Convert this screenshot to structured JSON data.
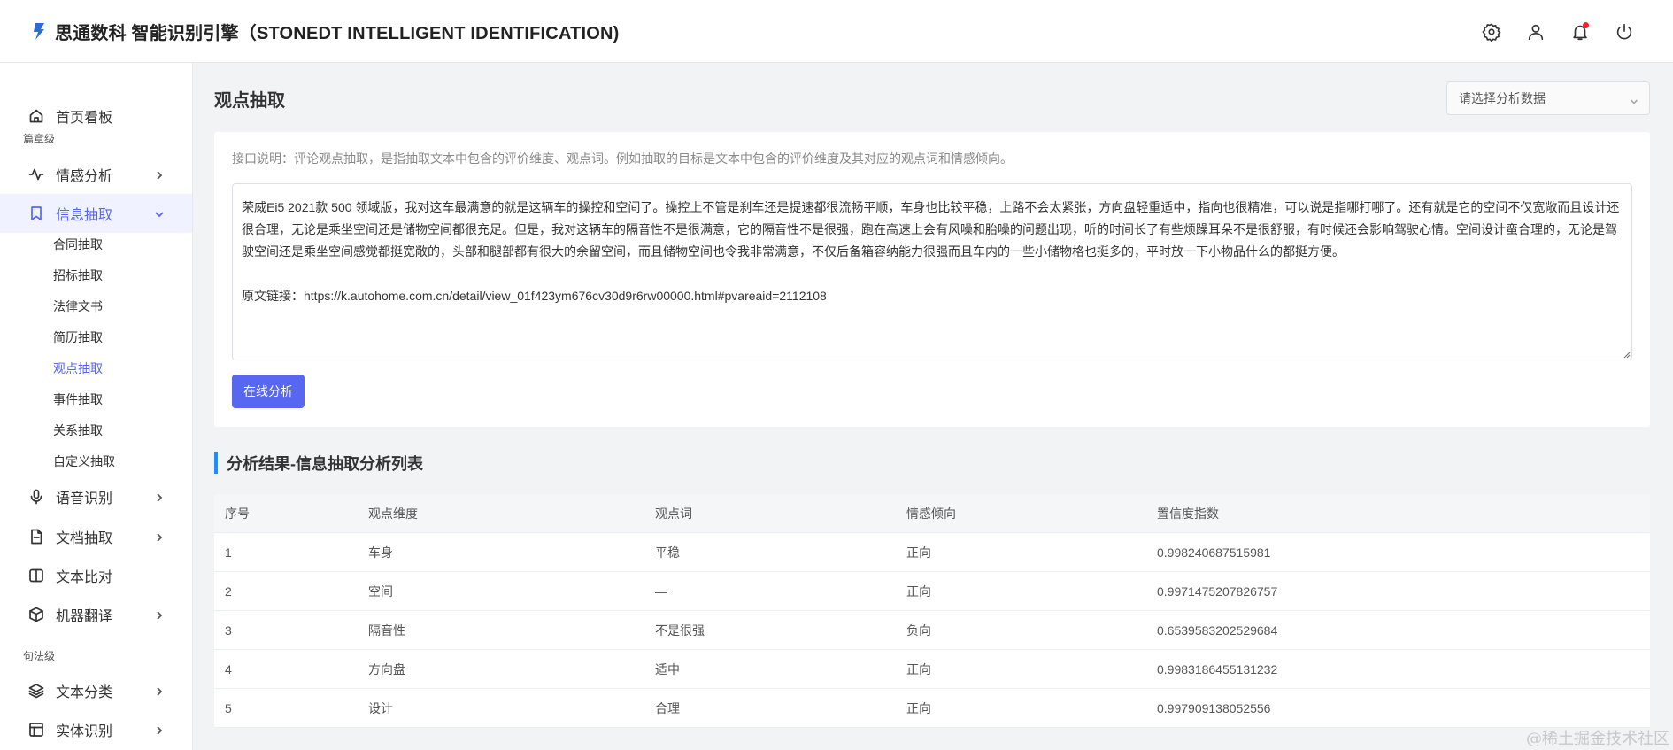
{
  "header": {
    "title": "思通数科 智能识别引擎（STONEDT INTELLIGENT IDENTIFICATION)",
    "icons": [
      "settings-icon",
      "user-icon",
      "bell-icon",
      "power-icon"
    ]
  },
  "sidebar": {
    "home": "首页看板",
    "group_chapter": "篇章级",
    "sentiment": "情感分析",
    "info_extract": "信息抽取",
    "sub_items": [
      "合同抽取",
      "招标抽取",
      "法律文书",
      "简历抽取",
      "观点抽取",
      "事件抽取",
      "关系抽取",
      "自定义抽取"
    ],
    "speech": "语音识别",
    "doc_extract": "文档抽取",
    "text_compare": "文本比对",
    "machine_translate": "机器翻译",
    "group_sentence": "句法级",
    "text_classify": "文本分类",
    "entity_recognize": "实体识别"
  },
  "main": {
    "title": "观点抽取",
    "select_placeholder": "请选择分析数据",
    "description": "接口说明：评论观点抽取，是指抽取文本中包含的评价维度、观点词。例如抽取的目标是文本中包含的评价维度及其对应的观点词和情感倾向。",
    "input_text": "荣威Ei5 2021款 500 领域版，我对这车最满意的就是这辆车的操控和空间了。操控上不管是刹车还是提速都很流畅平顺，车身也比较平稳，上路不会太紧张，方向盘轻重适中，指向也很精准，可以说是指哪打哪了。还有就是它的空间不仅宽敞而且设计还很合理，无论是乘坐空间还是储物空间都很充足。但是，我对这辆车的隔音性不是很满意，它的隔音性不是很强，跑在高速上会有风噪和胎噪的问题出现，听的时间长了有些烦躁耳朵不是很舒服，有时候还会影响驾驶心情。空间设计蛮合理的，无论是驾驶空间还是乘坐空间感觉都挺宽敞的，头部和腿部都有很大的余留空间，而且储物空间也令我非常满意，不仅后备箱容纳能力很强而且车内的一些小储物格也挺多的，平时放一下小物品什么的都挺方便。",
    "source_link": "原文链接：https://k.autohome.com.cn/detail/view_01f423ym676cv30d9r6rw00000.html#pvareaid=2112108",
    "analyze_button": "在线分析",
    "result_title": "分析结果-信息抽取分析列表"
  },
  "table": {
    "headers": [
      "序号",
      "观点维度",
      "观点词",
      "情感倾向",
      "置信度指数"
    ],
    "rows": [
      [
        "1",
        "车身",
        "平稳",
        "正向",
        "0.998240687515981"
      ],
      [
        "2",
        "空间",
        "—",
        "正向",
        "0.9971475207826757"
      ],
      [
        "3",
        "隔音性",
        "不是很强",
        "负向",
        "0.6539583202529684"
      ],
      [
        "4",
        "方向盘",
        "适中",
        "正向",
        "0.9983186455131232"
      ],
      [
        "5",
        "设计",
        "合理",
        "正向",
        "0.997909138052556"
      ]
    ]
  },
  "watermark": "@稀土掘金技术社区",
  "colors": {
    "accent": "#5867f0",
    "section_bar": "#1890ff",
    "notification": "#f5222d"
  }
}
